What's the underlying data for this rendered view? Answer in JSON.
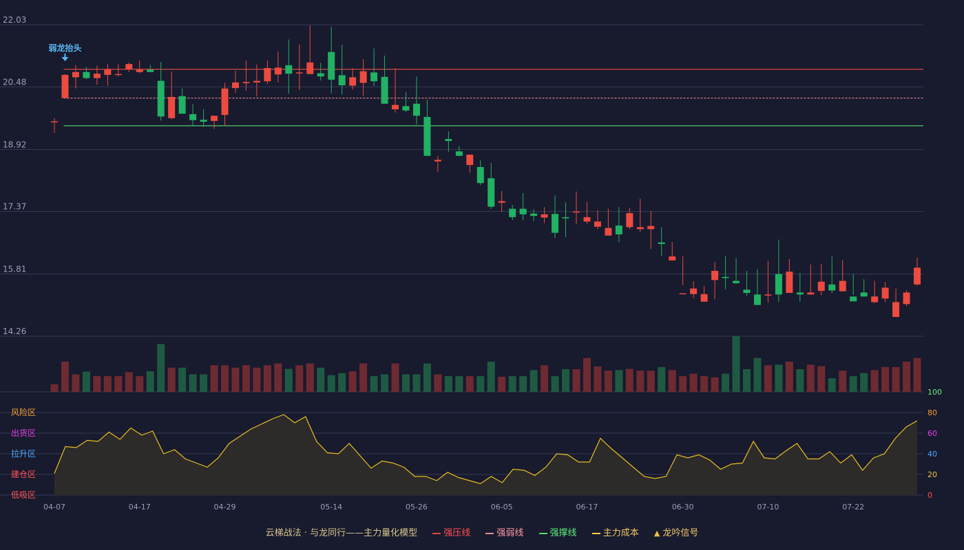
{
  "chart_data": {
    "type": "candlestick",
    "dates": [
      "04-07",
      "04-08",
      "04-09",
      "04-10",
      "04-11",
      "04-14",
      "04-15",
      "04-16",
      "04-17",
      "04-18",
      "04-21",
      "04-22",
      "04-23",
      "04-24",
      "04-25",
      "04-28",
      "04-29",
      "04-30",
      "05-02",
      "05-05",
      "05-06",
      "05-07",
      "05-08",
      "05-09",
      "05-12",
      "05-13",
      "05-14",
      "05-15",
      "05-16",
      "05-19",
      "05-20",
      "05-21",
      "05-22",
      "05-23",
      "05-26",
      "05-27",
      "05-28",
      "05-29",
      "05-30",
      "06-02",
      "06-03",
      "06-04",
      "06-05",
      "06-06",
      "06-09",
      "06-10",
      "06-11",
      "06-12",
      "06-13",
      "06-16",
      "06-17",
      "06-18",
      "06-19",
      "06-20",
      "06-23",
      "06-24",
      "06-25",
      "06-26",
      "06-27",
      "06-30",
      "07-01",
      "07-02",
      "07-03",
      "07-04",
      "07-07",
      "07-08",
      "07-09",
      "07-10",
      "07-11",
      "07-14",
      "07-15",
      "07-16",
      "07-17",
      "07-18",
      "07-21",
      "07-22",
      "07-23",
      "07-24",
      "07-25",
      "07-28",
      "07-29",
      "07-30"
    ],
    "open": [
      19.62,
      20.2,
      20.72,
      20.85,
      20.7,
      20.78,
      20.78,
      20.92,
      20.85,
      20.91,
      20.63,
      19.7,
      20.25,
      19.8,
      19.66,
      19.63,
      19.78,
      20.45,
      20.57,
      20.59,
      20.62,
      20.79,
      21.02,
      20.83,
      20.8,
      20.82,
      21.35,
      20.77,
      20.51,
      20.58,
      20.84,
      20.73,
      19.92,
      20.0,
      20.06,
      19.73,
      18.62,
      19.18,
      18.87,
      18.53,
      18.48,
      18.2,
      17.59,
      17.44,
      17.44,
      17.32,
      17.22,
      17.31,
      17.23,
      17.36,
      17.12,
      16.99,
      16.77,
      17.02,
      16.98,
      16.93,
      16.93,
      16.6,
      16.15,
      15.33,
      15.31,
      15.12,
      15.66,
      15.74,
      15.64,
      15.42,
      15.3,
      15.3,
      15.81,
      15.34,
      15.35,
      15.3,
      15.39,
      15.55,
      15.38,
      15.25,
      15.35,
      15.11,
      15.2,
      14.74,
      15.06,
      15.55
    ],
    "close": [
      19.62,
      20.78,
      20.85,
      20.7,
      20.81,
      20.91,
      20.8,
      21.05,
      20.91,
      20.85,
      19.74,
      20.23,
      19.81,
      19.65,
      19.61,
      19.76,
      20.44,
      20.59,
      20.6,
      20.63,
      20.95,
      20.96,
      20.81,
      20.84,
      21.09,
      20.74,
      20.66,
      20.52,
      20.72,
      20.87,
      20.62,
      20.06,
      20.03,
      19.89,
      19.76,
      18.76,
      18.66,
      19.13,
      18.76,
      18.79,
      18.08,
      17.49,
      17.63,
      17.23,
      17.3,
      17.26,
      17.3,
      16.84,
      17.2,
      17.37,
      17.23,
      17.12,
      16.96,
      16.8,
      17.33,
      16.98,
      17.01,
      16.56,
      16.25,
      15.33,
      15.45,
      15.31,
      15.89,
      15.71,
      15.58,
      15.34,
      15.04,
      15.3,
      15.3,
      15.87,
      15.3,
      15.35,
      15.62,
      15.4,
      15.64,
      15.13,
      15.25,
      15.25,
      15.47,
      15.11,
      15.35,
      15.97
    ],
    "high": [
      19.7,
      20.8,
      21.02,
      20.98,
      21.01,
      21.05,
      21.05,
      21.09,
      21.14,
      21.03,
      21.1,
      20.86,
      20.44,
      20.05,
      19.92,
      19.76,
      20.58,
      20.88,
      21.14,
      21.04,
      21.14,
      21.36,
      21.66,
      21.54,
      22.01,
      21.08,
      21.98,
      21.53,
      20.95,
      21.17,
      21.44,
      21.26,
      20.95,
      20.35,
      20.74,
      20.16,
      18.76,
      19.37,
      19.0,
      18.78,
      18.65,
      18.58,
      17.88,
      17.54,
      17.83,
      17.43,
      17.48,
      17.77,
      17.6,
      17.87,
      17.61,
      17.4,
      17.44,
      17.48,
      17.46,
      17.69,
      17.38,
      16.98,
      16.61,
      16.25,
      15.63,
      15.51,
      16.11,
      16.25,
      16.21,
      15.89,
      15.93,
      16.14,
      16.67,
      16.18,
      15.84,
      16.05,
      16.06,
      16.25,
      16.16,
      15.81,
      15.68,
      15.64,
      15.61,
      15.45,
      15.41,
      16.22
    ],
    "low": [
      19.33,
      20.24,
      20.44,
      20.67,
      20.53,
      20.51,
      20.74,
      20.85,
      20.82,
      20.88,
      19.64,
      19.67,
      19.96,
      19.49,
      19.48,
      19.43,
      19.51,
      20.33,
      20.38,
      20.24,
      20.55,
      20.59,
      20.31,
      20.4,
      20.8,
      20.64,
      20.32,
      20.29,
      20.41,
      20.26,
      20.5,
      20.34,
      19.84,
      19.85,
      19.54,
      18.91,
      18.36,
      18.86,
      18.75,
      18.34,
      18.03,
      17.43,
      17.36,
      17.16,
      17.15,
      17.13,
      17.08,
      16.71,
      16.73,
      17.05,
      17.06,
      16.93,
      16.79,
      16.61,
      16.93,
      16.86,
      16.44,
      16.26,
      16.25,
      15.53,
      15.21,
      15.14,
      15.18,
      15.43,
      15.57,
      15.27,
      15.03,
      15.1,
      15.11,
      15.4,
      15.12,
      15.3,
      15.28,
      15.33,
      15.42,
      15.29,
      15.33,
      15.08,
      15.11,
      14.81,
      15.01,
      15.52
    ],
    "volume": [
      25,
      100,
      58,
      67,
      52,
      52,
      52,
      65,
      52,
      68,
      158,
      80,
      80,
      58,
      58,
      88,
      88,
      80,
      88,
      80,
      88,
      94,
      76,
      88,
      94,
      80,
      55,
      62,
      68,
      94,
      52,
      58,
      94,
      58,
      58,
      94,
      58,
      52,
      52,
      52,
      52,
      100,
      50,
      52,
      52,
      72,
      88,
      52,
      75,
      75,
      112,
      84,
      70,
      72,
      76,
      70,
      70,
      82,
      72,
      52,
      60,
      52,
      48,
      60,
      184,
      75,
      112,
      88,
      90,
      100,
      75,
      90,
      85,
      45,
      70,
      52,
      62,
      72,
      82,
      82,
      100,
      112
    ],
    "ylim": [
      14.26,
      22.03
    ],
    "y_ticks": [
      "22.03",
      "20.48",
      "18.92",
      "17.37",
      "15.81",
      "14.26"
    ],
    "x_ticks": [
      "04-07",
      "04-17",
      "04-29",
      "05-14",
      "05-26",
      "06-05",
      "06-17",
      "06-30",
      "07-10",
      "07-22"
    ],
    "lines": {
      "强压线": 20.92,
      "强弱线": 20.2,
      "强撑线": 19.51
    },
    "annotation": {
      "text": "弱龙抬头",
      "date": "04-08"
    },
    "indicator": {
      "name": "主力量化模型",
      "ylim": [
        0,
        100
      ],
      "y_ticks": [
        "100",
        "80",
        "60",
        "40",
        "20",
        "0"
      ],
      "zones": [
        "风险区",
        "出货区",
        "拉升区",
        "建仓区",
        "低吸区"
      ],
      "values": [
        21,
        47,
        46,
        53,
        52,
        61,
        54,
        65,
        58,
        62,
        40,
        44,
        35,
        31,
        27,
        36,
        50,
        57,
        64,
        69,
        74,
        78,
        70,
        76,
        52,
        41,
        40,
        50,
        38,
        26,
        33,
        31,
        27,
        18,
        18,
        14,
        22,
        17,
        14,
        11,
        18,
        12,
        25,
        24,
        19,
        27,
        40,
        39,
        32,
        32,
        55,
        45,
        36,
        27,
        18,
        16,
        18,
        39,
        36,
        39,
        34,
        25,
        30,
        31,
        52,
        36,
        35,
        43,
        50,
        35,
        35,
        42,
        31,
        39,
        24,
        36,
        40,
        55,
        66,
        72
      ]
    }
  },
  "legend": {
    "title": "云梯战法 · 与龙同行——主力量化模型",
    "items": [
      "强压线",
      "强弱线",
      "强撑线",
      "主力成本",
      "龙吟信号"
    ]
  },
  "colors": {
    "background": "#181a2e",
    "up": "#ec4b3f",
    "down": "#21b263",
    "volume_up": "#6e2a31",
    "volume_down": "#1e5a42",
    "strong_pressure": "#d24a3c",
    "strong_weak": "#e48a92",
    "strong_support": "#55e070",
    "indicator_line": "#e8c020",
    "indicator_fill": "#2e2b2a",
    "grid": "#363a54",
    "axis_text": "#9aa0b8",
    "annotation": "#59b7f0"
  }
}
